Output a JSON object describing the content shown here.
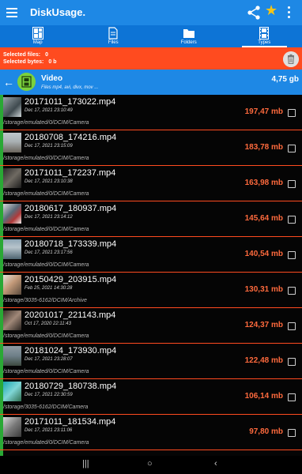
{
  "app": {
    "title": "DiskUsage.",
    "icons": {
      "menu": "hamburger-icon",
      "share": "share-icon",
      "favorite": "star-icon",
      "more": "more-vert-icon"
    },
    "colors": {
      "primary": "#1e88e5",
      "accent": "#ff4b1f",
      "size_text": "#ff6a3d",
      "star": "#f5c518",
      "video_icon": "#7bd13d"
    }
  },
  "tabs": [
    {
      "label": "Map",
      "icon": "map-icon"
    },
    {
      "label": "Files",
      "icon": "file-icon"
    },
    {
      "label": "Folders",
      "icon": "folder-icon"
    },
    {
      "label": "Types",
      "icon": "film-icon",
      "active": true
    }
  ],
  "selection": {
    "files_label": "Selected files:",
    "files_value": "0",
    "bytes_label": "Selected bytes:",
    "bytes_value": "0 b"
  },
  "folder": {
    "name": "Video",
    "subtitle": "Files mp4, avi, divx, mov ...",
    "size": "4,75 gb"
  },
  "files": [
    {
      "name": "20171011_173022.mp4",
      "date": "Dec 17, 2021 23:10:49",
      "size": "197,47 mb",
      "path": "/storage/emulated/0/DCIM/Camera"
    },
    {
      "name": "20180708_174216.mp4",
      "date": "Dec 17, 2021 23:15:09",
      "size": "183,78 mb",
      "path": "/storage/emulated/0/DCIM/Camera"
    },
    {
      "name": "20171011_172237.mp4",
      "date": "Dec 17, 2021 23:10:38",
      "size": "163,98 mb",
      "path": "/storage/emulated/0/DCIM/Camera"
    },
    {
      "name": "20180617_180937.mp4",
      "date": "Dec 17, 2021 23:14:12",
      "size": "145,64 mb",
      "path": "/storage/emulated/0/DCIM/Camera"
    },
    {
      "name": "20180718_173339.mp4",
      "date": "Dec 17, 2021 23:17:56",
      "size": "140,54 mb",
      "path": "/storage/emulated/0/DCIM/Camera"
    },
    {
      "name": "20150429_203915.mp4",
      "date": "Feb 25, 2021 14:30:28",
      "size": "130,31 mb",
      "path": "/storage/3035-6162/DCIM/Archive"
    },
    {
      "name": "20201017_221143.mp4",
      "date": "Oct 17, 2020 22:11:43",
      "size": "124,37 mb",
      "path": "/storage/emulated/0/DCIM/Camera"
    },
    {
      "name": "20181024_173930.mp4",
      "date": "Dec 17, 2021 23:28:07",
      "size": "122,48 mb",
      "path": "/storage/emulated/0/DCIM/Camera"
    },
    {
      "name": "20180729_180738.mp4",
      "date": "Dec 17, 2021 22:30:59",
      "size": "106,14 mb",
      "path": "/storage/3035-6162/DCIM/Camera"
    },
    {
      "name": "20171011_181534.mp4",
      "date": "Dec 17, 2021 23:11:06",
      "size": "97,80 mb",
      "path": "/storage/emulated/0/DCIM/Camera"
    }
  ],
  "navbar": {
    "recents": "|||",
    "home": "○",
    "back": "‹"
  }
}
